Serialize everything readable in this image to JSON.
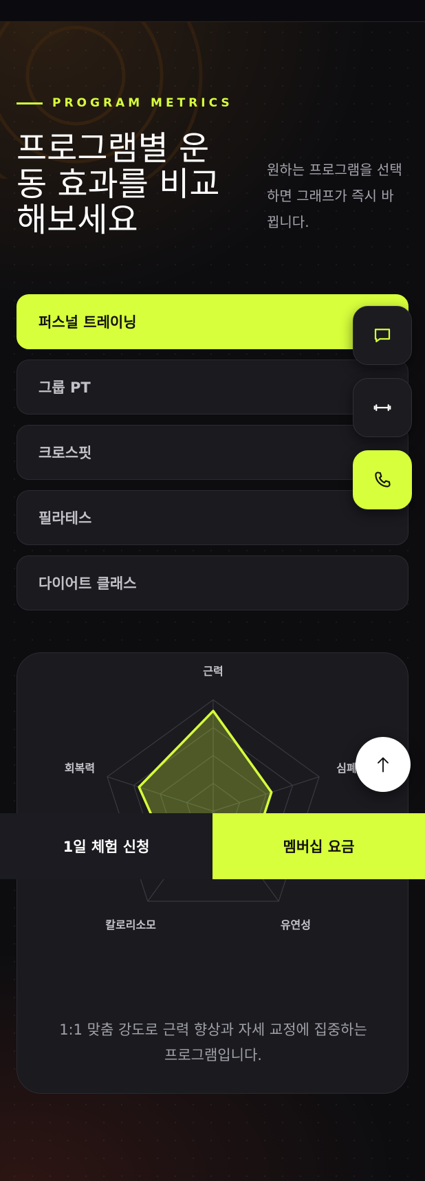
{
  "header": {
    "eyebrow": "PROGRAM METRICS",
    "title": "프로그램별 운동 효과를 비교해보세요",
    "description": "원하는 프로그램을 선택하면 그래프가 즉시 바뀝니다."
  },
  "programs": [
    {
      "label": "퍼스널 트레이닝",
      "active": true
    },
    {
      "label": "그룹 PT",
      "active": false
    },
    {
      "label": "크로스핏",
      "active": false
    },
    {
      "label": "필라테스",
      "active": false
    },
    {
      "label": "다이어트 클래스",
      "active": false
    }
  ],
  "floating_actions": [
    {
      "name": "chat",
      "icon": "chat-bubble-icon"
    },
    {
      "name": "workout",
      "icon": "dumbbell-icon"
    },
    {
      "name": "call",
      "icon": "phone-icon"
    }
  ],
  "chart_data": {
    "type": "radar",
    "axes": [
      "근력",
      "심폐",
      "유연성",
      "칼로리소모",
      "회복력"
    ],
    "max": 100,
    "rings": 4,
    "series": [
      {
        "values": [
          90,
          55,
          55,
          60,
          70
        ]
      }
    ],
    "colors": {
      "stroke": "#d7ff3c",
      "fill": "rgba(215,255,60,0.28)"
    },
    "caption": "1:1 맞춤 강도로 근력 향상과 자세 교정에 집중하는 프로그램입니다."
  },
  "back_to_top": {
    "icon": "arrow-up-icon"
  },
  "bottom_bar": {
    "trial_label": "1일 체험 신청",
    "membership_label": "멤버십 요금"
  },
  "colors": {
    "accent": "#d7ff3c",
    "background": "#0d0d10",
    "card": "#1a1a1f"
  }
}
